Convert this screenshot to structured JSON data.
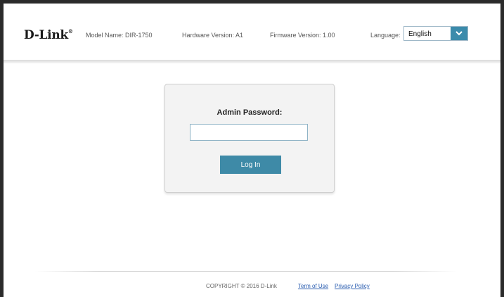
{
  "header": {
    "logo_text": "D-Link",
    "logo_mark": "®",
    "model": "Model Name: DIR-1750",
    "hardware": "Hardware Version: A1",
    "firmware": "Firmware Version: 1.00",
    "language_label": "Language:",
    "language_value": "English",
    "language_icon": "chevron-down-icon"
  },
  "login": {
    "label": "Admin Password:",
    "password_value": "",
    "button_label": "Log In"
  },
  "footer": {
    "copyright": "COPYRIGHT © 2016 D-Link",
    "term_link": "Term of Use",
    "privacy_link": "Privacy Policy"
  },
  "colors": {
    "accent": "#3e8aa7",
    "link": "#2a5db0",
    "border": "#2b2b2b"
  }
}
